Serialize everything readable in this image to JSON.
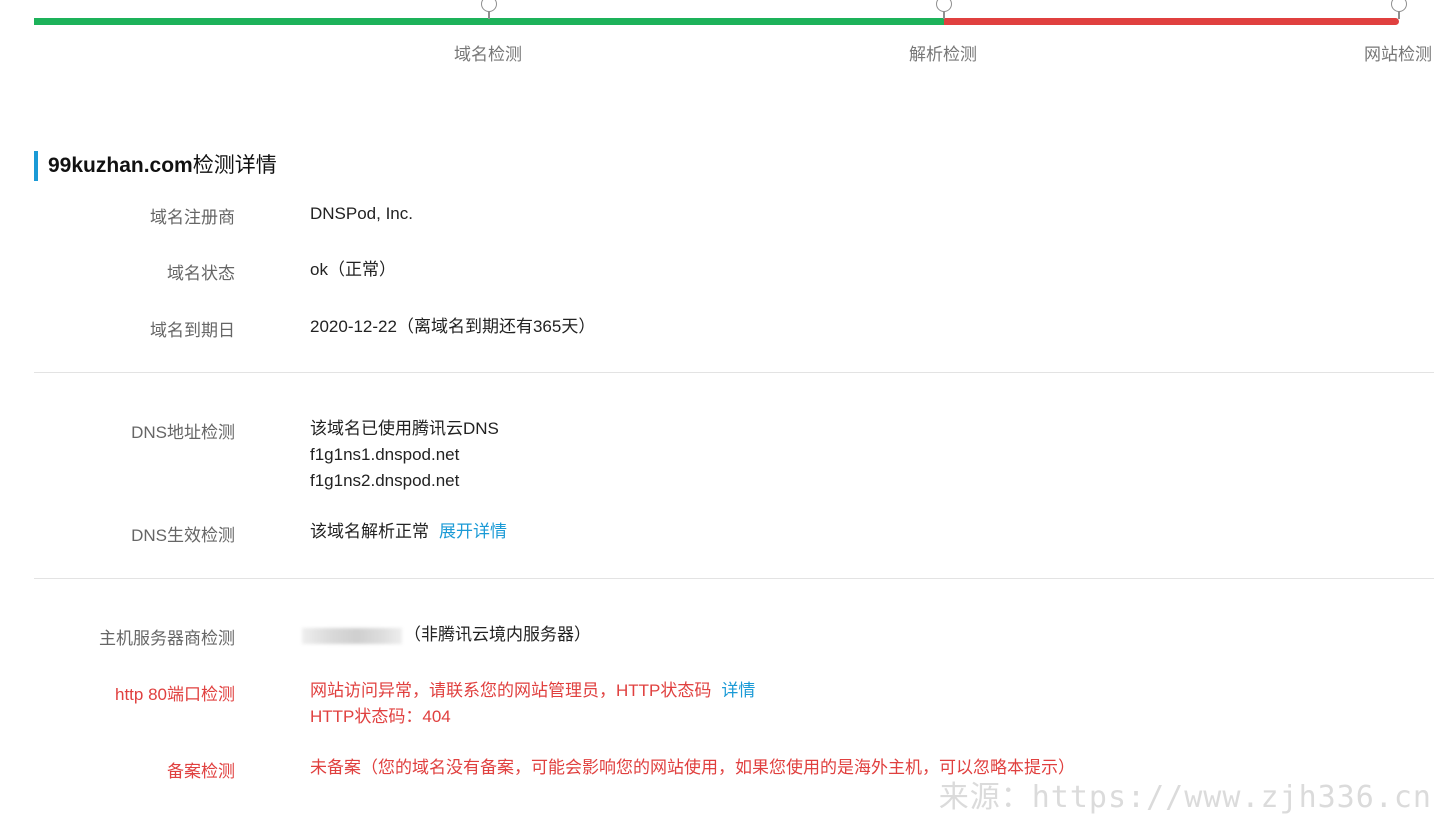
{
  "steps": [
    {
      "label": "域名检测"
    },
    {
      "label": "解析检测"
    },
    {
      "label": "网站检测"
    }
  ],
  "progress_colors": {
    "done": "#1db25a",
    "failed": "#e0403f"
  },
  "section": {
    "domain": "99kuzhan.com",
    "title_suffix": "检测详情"
  },
  "domain_info": {
    "registrar": {
      "label": "域名注册商",
      "value": "DNSPod, Inc."
    },
    "status": {
      "label": "域名状态",
      "value": "ok（正常）"
    },
    "expiry": {
      "label": "域名到期日",
      "value": "2020-12-22（离域名到期还有365天）"
    }
  },
  "dns": {
    "address": {
      "label": "DNS地址检测",
      "lines": [
        "该域名已使用腾讯云DNS",
        "f1g1ns1.dnspod.net",
        "f1g1ns2.dnspod.net"
      ]
    },
    "effect": {
      "label": "DNS生效检测",
      "value": "该域名解析正常",
      "link": "展开详情"
    }
  },
  "host": {
    "server": {
      "label": "主机服务器商检测",
      "value": "（非腾讯云境内服务器）"
    },
    "http80": {
      "label": "http 80端口检测",
      "line1": "网站访问异常，请联系您的网站管理员，HTTP状态码",
      "link": "详情",
      "line2": "HTTP状态码：404"
    },
    "icp": {
      "label": "备案检测",
      "value": "未备案（您的域名没有备案，可能会影响您的网站使用，如果您使用的是海外主机，可以忽略本提示）"
    }
  },
  "watermark": "来源：https://www.zjh336.cn"
}
